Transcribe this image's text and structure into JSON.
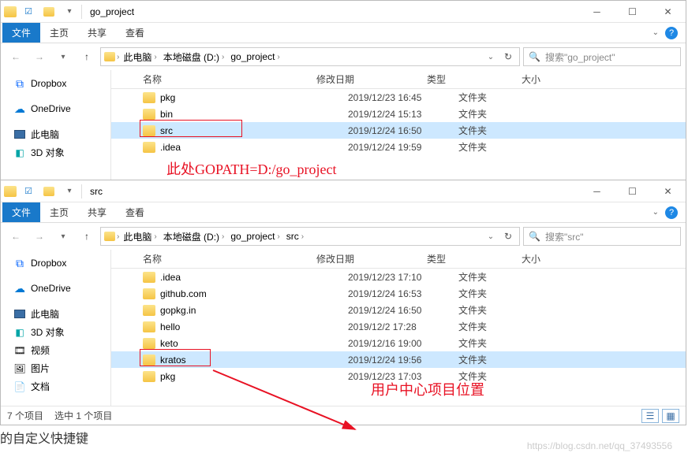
{
  "win1": {
    "title": "go_project",
    "tabs": {
      "file": "文件",
      "home": "主页",
      "share": "共享",
      "view": "查看"
    },
    "crumbs": [
      "此电脑",
      "本地磁盘 (D:)",
      "go_project"
    ],
    "search_ph": "搜索\"go_project\"",
    "columns": {
      "name": "名称",
      "date": "修改日期",
      "type": "类型",
      "size": "大小"
    },
    "rows": [
      {
        "name": "pkg",
        "date": "2019/12/23 16:45",
        "type": "文件夹",
        "sel": false
      },
      {
        "name": "bin",
        "date": "2019/12/24 15:13",
        "type": "文件夹",
        "sel": false
      },
      {
        "name": "src",
        "date": "2019/12/24 16:50",
        "type": "文件夹",
        "sel": true
      },
      {
        "name": ".idea",
        "date": "2019/12/24 19:59",
        "type": "文件夹",
        "sel": false
      }
    ],
    "annotation": "此处GOPATH=D:/go_project"
  },
  "win2": {
    "title": "src",
    "tabs": {
      "file": "文件",
      "home": "主页",
      "share": "共享",
      "view": "查看"
    },
    "crumbs": [
      "此电脑",
      "本地磁盘 (D:)",
      "go_project",
      "src"
    ],
    "search_ph": "搜索\"src\"",
    "columns": {
      "name": "名称",
      "date": "修改日期",
      "type": "类型",
      "size": "大小"
    },
    "rows": [
      {
        "name": ".idea",
        "date": "2019/12/23 17:10",
        "type": "文件夹",
        "sel": false
      },
      {
        "name": "github.com",
        "date": "2019/12/24 16:53",
        "type": "文件夹",
        "sel": false
      },
      {
        "name": "gopkg.in",
        "date": "2019/12/24 16:50",
        "type": "文件夹",
        "sel": false
      },
      {
        "name": "hello",
        "date": "2019/12/2 17:28",
        "type": "文件夹",
        "sel": false
      },
      {
        "name": "keto",
        "date": "2019/12/16 19:00",
        "type": "文件夹",
        "sel": false
      },
      {
        "name": "kratos",
        "date": "2019/12/24 19:56",
        "type": "文件夹",
        "sel": true
      },
      {
        "name": "pkg",
        "date": "2019/12/23 17:03",
        "type": "文件夹",
        "sel": false
      }
    ],
    "status": {
      "count": "7 个项目",
      "selected": "选中 1 个项目"
    },
    "annotation": "用户中心项目位置"
  },
  "sidebar": {
    "dropbox": "Dropbox",
    "onedrive": "OneDrive",
    "thispc": "此电脑",
    "obj3d": "3D 对象",
    "video": "视频",
    "pictures": "图片",
    "documents": "文档"
  },
  "misc": {
    "shortcut": "的自定义快捷键",
    "watermark": "https://blog.csdn.net/qq_37493556"
  }
}
